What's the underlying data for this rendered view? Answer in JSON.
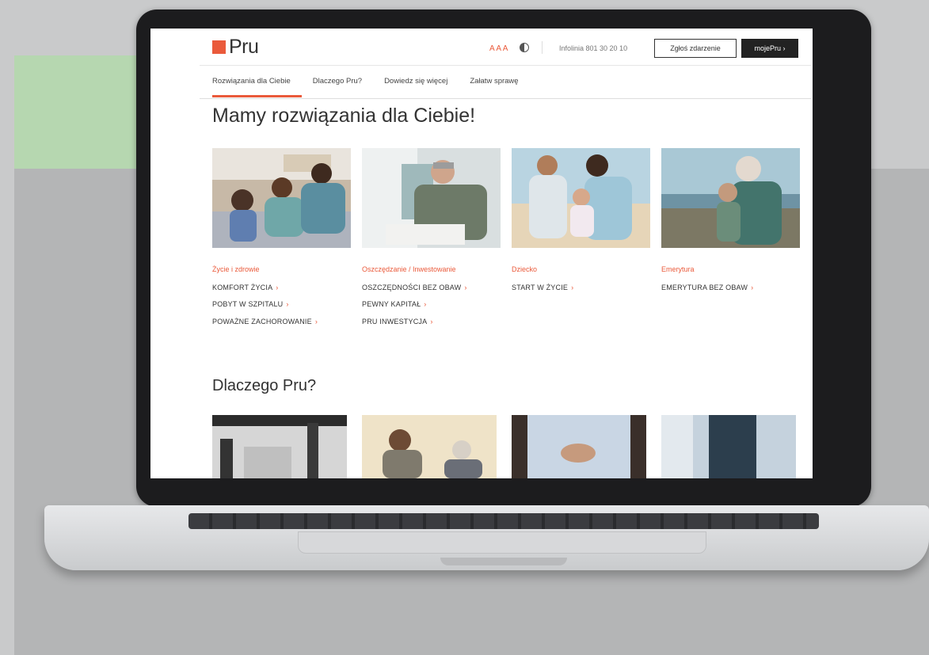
{
  "brand": {
    "name": "Pru",
    "accent": "#ea5a3b"
  },
  "header": {
    "font_size_control": "A A A",
    "infoline": "Infolinia 801 30 20 10",
    "report_button": "Zgłoś zdarzenie",
    "account_button": "mojePru ›"
  },
  "nav": {
    "items": [
      "Rozwiązania dla Ciebie",
      "Dlaczego Pru?",
      "Dowiedz się więcej",
      "Załatw sprawę"
    ]
  },
  "main": {
    "title": "Mamy rozwiązania dla Ciebie!",
    "categories": [
      {
        "title": "Życie i zdrowie",
        "links": [
          "KOMFORT ŻYCIA",
          "POBYT W SZPITALU",
          "POWAŻNE ZACHOROWANIE"
        ]
      },
      {
        "title": "Oszczędzanie / Inwestowanie",
        "links": [
          "OSZCZĘDNOŚCI BEZ OBAW",
          "PEWNY KAPITAŁ",
          "PRU INWESTYCJA"
        ]
      },
      {
        "title": "Dziecko",
        "links": [
          "START W ŻYCIE"
        ]
      },
      {
        "title": "Emerytura",
        "links": [
          "EMERYTURA BEZ OBAW"
        ]
      }
    ],
    "why_title": "Dlaczego Pru?"
  },
  "icons": {
    "chevron": "›",
    "contrast": "contrast-icon"
  }
}
